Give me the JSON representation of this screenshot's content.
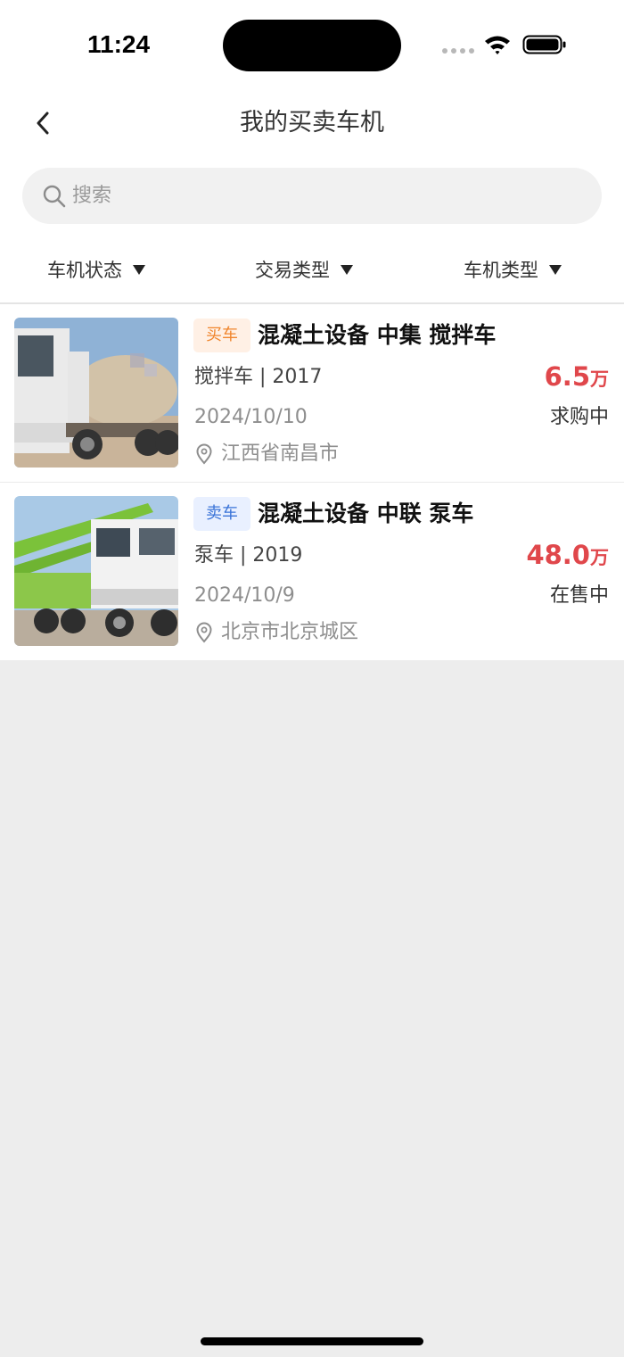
{
  "status_bar": {
    "time": "11:24"
  },
  "header": {
    "title": "我的买卖车机"
  },
  "search": {
    "placeholder": "搜索"
  },
  "filters": [
    {
      "label": "车机状态"
    },
    {
      "label": "交易类型"
    },
    {
      "label": "车机类型"
    }
  ],
  "listings": [
    {
      "tag": "买车",
      "title": "混凝土设备 中集 搅拌车",
      "spec": "搅拌车 | 2017",
      "price": "6.5",
      "price_unit": "万",
      "date": "2024/10/10",
      "status": "求购中",
      "location": "江西省南昌市"
    },
    {
      "tag": "卖车",
      "title": "混凝土设备 中联 泵车",
      "spec": "泵车 | 2019",
      "price": "48.0",
      "price_unit": "万",
      "date": "2024/10/9",
      "status": "在售中",
      "location": "北京市北京城区"
    }
  ],
  "colors": {
    "price": "#e0474b",
    "buy_tag_text": "#f0862e",
    "sell_tag_text": "#3b74d8",
    "background": "#ededed"
  }
}
